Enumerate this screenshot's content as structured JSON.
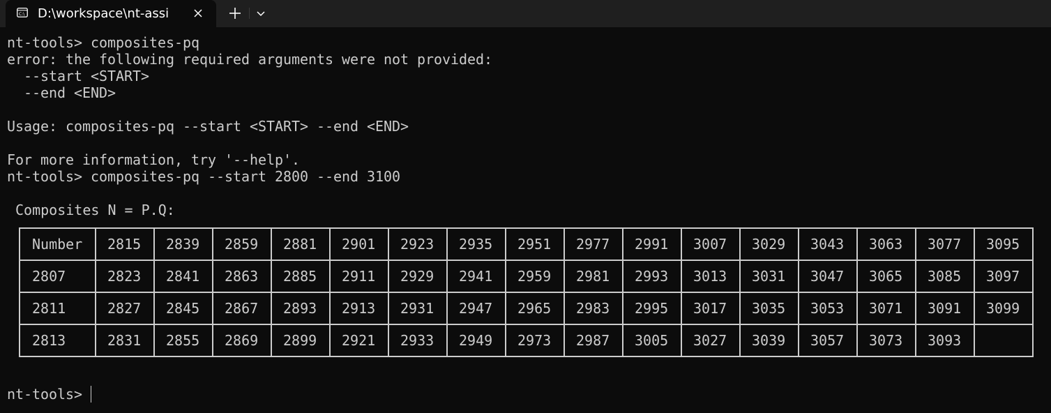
{
  "tab": {
    "title": "D:\\workspace\\nt-assi"
  },
  "icons": {
    "tab": "terminal-icon",
    "close": "close-icon",
    "new_tab": "plus-icon",
    "dropdown": "chevron-down-icon"
  },
  "terminal": {
    "lines": [
      "nt-tools> composites-pq",
      "error: the following required arguments were not provided:",
      "  --start <START>",
      "  --end <END>",
      "",
      "Usage: composites-pq --start <START> --end <END>",
      "",
      "For more information, try '--help'.",
      "nt-tools> composites-pq --start 2800 --end 3100"
    ],
    "table_title": "Composites N = P.Q:",
    "table_rows": [
      [
        "Number",
        "2815",
        "2839",
        "2859",
        "2881",
        "2901",
        "2923",
        "2935",
        "2951",
        "2977",
        "2991",
        "3007",
        "3029",
        "3043",
        "3063",
        "3077",
        "3095"
      ],
      [
        "2807",
        "2823",
        "2841",
        "2863",
        "2885",
        "2911",
        "2929",
        "2941",
        "2959",
        "2981",
        "2993",
        "3013",
        "3031",
        "3047",
        "3065",
        "3085",
        "3097"
      ],
      [
        "2811",
        "2827",
        "2845",
        "2867",
        "2893",
        "2913",
        "2931",
        "2947",
        "2965",
        "2983",
        "2995",
        "3017",
        "3035",
        "3053",
        "3071",
        "3091",
        "3099"
      ],
      [
        "2813",
        "2831",
        "2855",
        "2869",
        "2899",
        "2921",
        "2933",
        "2949",
        "2973",
        "2987",
        "3005",
        "3027",
        "3039",
        "3057",
        "3073",
        "3093",
        ""
      ]
    ],
    "prompt": "nt-tools> "
  },
  "colors": {
    "background": "#0c0c0c",
    "tabbar": "#1f1f1f",
    "text": "#cccccc"
  }
}
